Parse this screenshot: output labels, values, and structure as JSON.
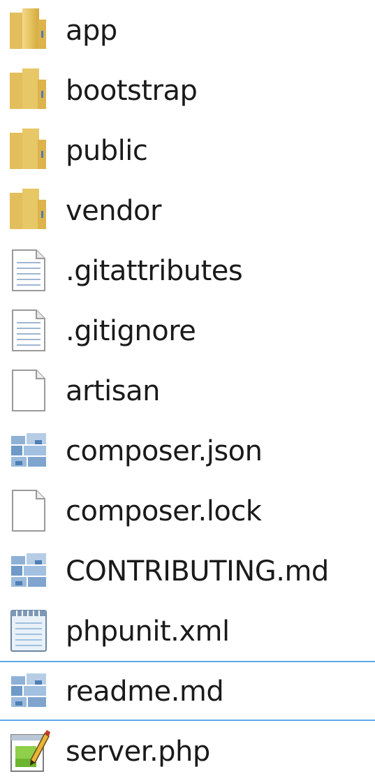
{
  "files": [
    {
      "name": "app",
      "icon": "folder-icon",
      "type": "folder"
    },
    {
      "name": "bootstrap",
      "icon": "folder-icon",
      "type": "folder"
    },
    {
      "name": "public",
      "icon": "folder-icon",
      "type": "folder"
    },
    {
      "name": "vendor",
      "icon": "folder-icon",
      "type": "folder"
    },
    {
      "name": ".gitattributes",
      "icon": "text-file-icon",
      "type": "text"
    },
    {
      "name": ".gitignore",
      "icon": "text-file-icon",
      "type": "text"
    },
    {
      "name": "artisan",
      "icon": "blank-file-icon",
      "type": "blank"
    },
    {
      "name": "composer.json",
      "icon": "app-file-icon",
      "type": "app"
    },
    {
      "name": "composer.lock",
      "icon": "blank-file-icon",
      "type": "blank"
    },
    {
      "name": "CONTRIBUTING.md",
      "icon": "app-file-icon",
      "type": "app"
    },
    {
      "name": "phpunit.xml",
      "icon": "notepad-file-icon",
      "type": "notepad"
    },
    {
      "name": "readme.md",
      "icon": "app-file-icon",
      "type": "app",
      "selected": true
    },
    {
      "name": "server.php",
      "icon": "php-edit-file-icon",
      "type": "php"
    }
  ],
  "colors": {
    "selection_border": "#5fa8e8",
    "folder": "#e8c766",
    "text": "#1a1a1a"
  }
}
